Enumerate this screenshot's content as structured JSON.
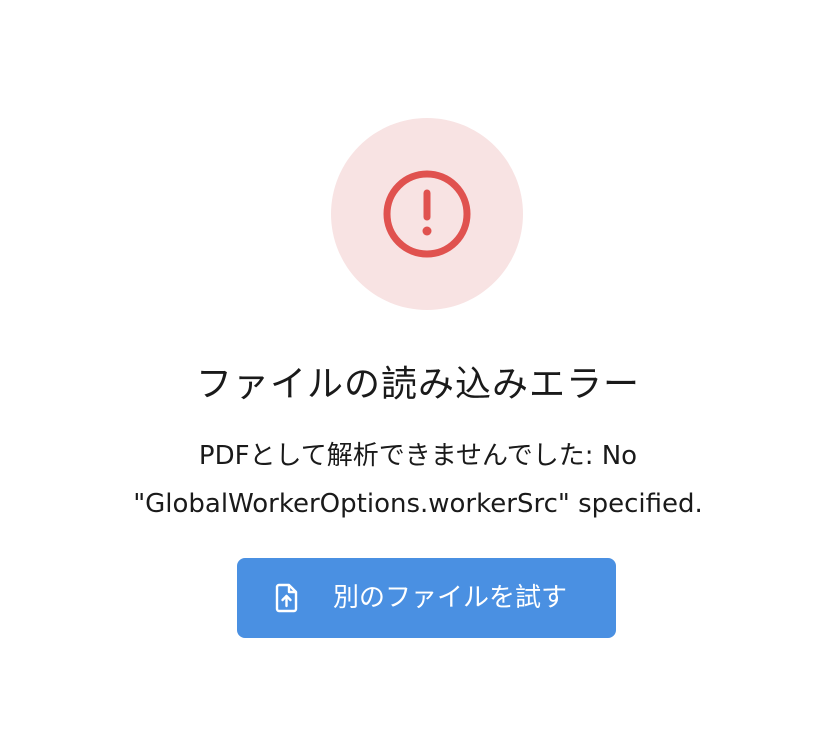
{
  "error": {
    "icon": "alert-circle-icon",
    "title": "ファイルの読み込みエラー",
    "message_line1": "PDFとして解析できませんでした: No",
    "message_line2": "\"GlobalWorkerOptions.workerSrc\" specified."
  },
  "retry_button": {
    "icon": "file-upload-icon",
    "label": "別のファイルを試す"
  },
  "colors": {
    "icon_bg": "#f8e3e3",
    "icon_stroke": "#e0524f",
    "button_bg": "#4a90e2",
    "button_text": "#ffffff"
  }
}
